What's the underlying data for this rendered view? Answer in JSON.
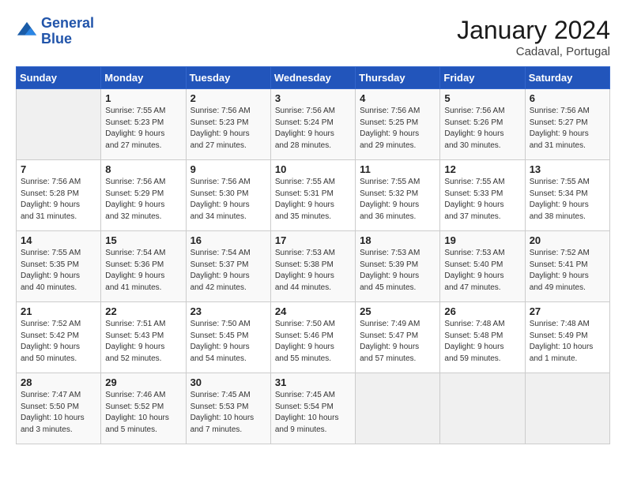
{
  "logo": {
    "line1": "General",
    "line2": "Blue"
  },
  "title": "January 2024",
  "location": "Cadaval, Portugal",
  "weekdays": [
    "Sunday",
    "Monday",
    "Tuesday",
    "Wednesday",
    "Thursday",
    "Friday",
    "Saturday"
  ],
  "weeks": [
    [
      {
        "day": "",
        "info": ""
      },
      {
        "day": "1",
        "info": "Sunrise: 7:55 AM\nSunset: 5:23 PM\nDaylight: 9 hours\nand 27 minutes."
      },
      {
        "day": "2",
        "info": "Sunrise: 7:56 AM\nSunset: 5:23 PM\nDaylight: 9 hours\nand 27 minutes."
      },
      {
        "day": "3",
        "info": "Sunrise: 7:56 AM\nSunset: 5:24 PM\nDaylight: 9 hours\nand 28 minutes."
      },
      {
        "day": "4",
        "info": "Sunrise: 7:56 AM\nSunset: 5:25 PM\nDaylight: 9 hours\nand 29 minutes."
      },
      {
        "day": "5",
        "info": "Sunrise: 7:56 AM\nSunset: 5:26 PM\nDaylight: 9 hours\nand 30 minutes."
      },
      {
        "day": "6",
        "info": "Sunrise: 7:56 AM\nSunset: 5:27 PM\nDaylight: 9 hours\nand 31 minutes."
      }
    ],
    [
      {
        "day": "7",
        "info": "Sunrise: 7:56 AM\nSunset: 5:28 PM\nDaylight: 9 hours\nand 31 minutes."
      },
      {
        "day": "8",
        "info": "Sunrise: 7:56 AM\nSunset: 5:29 PM\nDaylight: 9 hours\nand 32 minutes."
      },
      {
        "day": "9",
        "info": "Sunrise: 7:56 AM\nSunset: 5:30 PM\nDaylight: 9 hours\nand 34 minutes."
      },
      {
        "day": "10",
        "info": "Sunrise: 7:55 AM\nSunset: 5:31 PM\nDaylight: 9 hours\nand 35 minutes."
      },
      {
        "day": "11",
        "info": "Sunrise: 7:55 AM\nSunset: 5:32 PM\nDaylight: 9 hours\nand 36 minutes."
      },
      {
        "day": "12",
        "info": "Sunrise: 7:55 AM\nSunset: 5:33 PM\nDaylight: 9 hours\nand 37 minutes."
      },
      {
        "day": "13",
        "info": "Sunrise: 7:55 AM\nSunset: 5:34 PM\nDaylight: 9 hours\nand 38 minutes."
      }
    ],
    [
      {
        "day": "14",
        "info": "Sunrise: 7:55 AM\nSunset: 5:35 PM\nDaylight: 9 hours\nand 40 minutes."
      },
      {
        "day": "15",
        "info": "Sunrise: 7:54 AM\nSunset: 5:36 PM\nDaylight: 9 hours\nand 41 minutes."
      },
      {
        "day": "16",
        "info": "Sunrise: 7:54 AM\nSunset: 5:37 PM\nDaylight: 9 hours\nand 42 minutes."
      },
      {
        "day": "17",
        "info": "Sunrise: 7:53 AM\nSunset: 5:38 PM\nDaylight: 9 hours\nand 44 minutes."
      },
      {
        "day": "18",
        "info": "Sunrise: 7:53 AM\nSunset: 5:39 PM\nDaylight: 9 hours\nand 45 minutes."
      },
      {
        "day": "19",
        "info": "Sunrise: 7:53 AM\nSunset: 5:40 PM\nDaylight: 9 hours\nand 47 minutes."
      },
      {
        "day": "20",
        "info": "Sunrise: 7:52 AM\nSunset: 5:41 PM\nDaylight: 9 hours\nand 49 minutes."
      }
    ],
    [
      {
        "day": "21",
        "info": "Sunrise: 7:52 AM\nSunset: 5:42 PM\nDaylight: 9 hours\nand 50 minutes."
      },
      {
        "day": "22",
        "info": "Sunrise: 7:51 AM\nSunset: 5:43 PM\nDaylight: 9 hours\nand 52 minutes."
      },
      {
        "day": "23",
        "info": "Sunrise: 7:50 AM\nSunset: 5:45 PM\nDaylight: 9 hours\nand 54 minutes."
      },
      {
        "day": "24",
        "info": "Sunrise: 7:50 AM\nSunset: 5:46 PM\nDaylight: 9 hours\nand 55 minutes."
      },
      {
        "day": "25",
        "info": "Sunrise: 7:49 AM\nSunset: 5:47 PM\nDaylight: 9 hours\nand 57 minutes."
      },
      {
        "day": "26",
        "info": "Sunrise: 7:48 AM\nSunset: 5:48 PM\nDaylight: 9 hours\nand 59 minutes."
      },
      {
        "day": "27",
        "info": "Sunrise: 7:48 AM\nSunset: 5:49 PM\nDaylight: 10 hours\nand 1 minute."
      }
    ],
    [
      {
        "day": "28",
        "info": "Sunrise: 7:47 AM\nSunset: 5:50 PM\nDaylight: 10 hours\nand 3 minutes."
      },
      {
        "day": "29",
        "info": "Sunrise: 7:46 AM\nSunset: 5:52 PM\nDaylight: 10 hours\nand 5 minutes."
      },
      {
        "day": "30",
        "info": "Sunrise: 7:45 AM\nSunset: 5:53 PM\nDaylight: 10 hours\nand 7 minutes."
      },
      {
        "day": "31",
        "info": "Sunrise: 7:45 AM\nSunset: 5:54 PM\nDaylight: 10 hours\nand 9 minutes."
      },
      {
        "day": "",
        "info": ""
      },
      {
        "day": "",
        "info": ""
      },
      {
        "day": "",
        "info": ""
      }
    ]
  ]
}
